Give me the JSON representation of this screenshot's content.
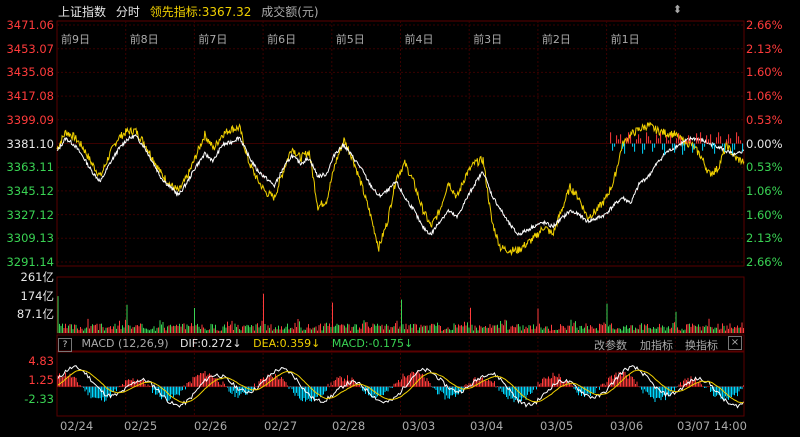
{
  "header": {
    "index_name": "上证指数",
    "period": "分时",
    "leader_label": "领先指标:3367.32",
    "volume_label": "成交额(元)"
  },
  "pin_icon": "pin-icon",
  "price_axis": {
    "left": [
      "3471.06",
      "3453.07",
      "3435.08",
      "3417.08",
      "3399.09",
      "3381.10",
      "3363.11",
      "3345.12",
      "3327.12",
      "3309.13",
      "3291.14"
    ],
    "right": [
      "2.66%",
      "2.13%",
      "1.60%",
      "1.06%",
      "0.53%",
      "0.00%",
      "0.53%",
      "1.06%",
      "1.60%",
      "2.13%",
      "2.66%"
    ]
  },
  "day_labels": [
    "前9日",
    "前8日",
    "前7日",
    "前6日",
    "前5日",
    "前4日",
    "前3日",
    "前2日",
    "前1日"
  ],
  "volume_axis": [
    "261亿",
    "174亿",
    "87.1亿"
  ],
  "macd": {
    "help": "?",
    "name": "MACD (12,26,9)",
    "dif": "DIF:0.272↓",
    "dea": "DEA:0.359↓",
    "macd": "MACD:-0.175↓",
    "axis": [
      "4.83",
      "1.25",
      "-2.33"
    ],
    "tools": {
      "edit": "改参数",
      "add": "加指标",
      "switch": "换指标",
      "close": "×"
    }
  },
  "x_axis": [
    "02/24",
    "02/25",
    "02/26",
    "02/27",
    "02/28",
    "03/03",
    "03/04",
    "03/05",
    "03/06",
    "03/07 14:00"
  ],
  "colors": {
    "up": "#ff3b3b",
    "down": "#39d353",
    "price": "#ffffff",
    "leader": "#f0d000",
    "grid": "#3a0000",
    "macd_neg": "#00d8ff"
  },
  "chart_data": {
    "type": "line",
    "days": [
      "02/24",
      "02/25",
      "02/26",
      "02/27",
      "02/28",
      "03/03",
      "03/04",
      "03/05",
      "03/06",
      "03/07"
    ],
    "series": [
      {
        "values": [
          3375,
          3385,
          3380,
          3371,
          3360,
          3352,
          3365,
          3376,
          3384,
          3387,
          3379,
          3367,
          3355,
          3348,
          3342,
          3352,
          3364,
          3373,
          3368,
          3380,
          3382,
          3386,
          3372,
          3361,
          3355,
          3349,
          3362,
          3372,
          3366,
          3370,
          3356,
          3358,
          3374,
          3380,
          3371,
          3362,
          3350,
          3341,
          3345,
          3352,
          3340,
          3331,
          3318,
          3312,
          3322,
          3330,
          3325,
          3338,
          3350,
          3360,
          3342,
          3331,
          3320,
          3312,
          3315,
          3319,
          3321,
          3318,
          3324,
          3330,
          3327,
          3322,
          3324,
          3327,
          3334,
          3340,
          3336,
          3351,
          3356,
          3366,
          3374,
          3378,
          3382,
          3385,
          3384,
          3381,
          3379,
          3375,
          3372,
          3376
        ]
      },
      {
        "name": "领先指标",
        "values": [
          3377,
          3390,
          3386,
          3378,
          3366,
          3356,
          3372,
          3385,
          3390,
          3391,
          3382,
          3370,
          3358,
          3350,
          3345,
          3356,
          3372,
          3388,
          3377,
          3388,
          3392,
          3393,
          3368,
          3354,
          3344,
          3340,
          3360,
          3378,
          3370,
          3375,
          3333,
          3338,
          3366,
          3384,
          3370,
          3350,
          3328,
          3302,
          3322,
          3355,
          3366,
          3352,
          3332,
          3318,
          3330,
          3352,
          3340,
          3357,
          3366,
          3369,
          3322,
          3302,
          3300,
          3300,
          3305,
          3310,
          3318,
          3312,
          3330,
          3348,
          3340,
          3325,
          3330,
          3338,
          3352,
          3380,
          3388,
          3392,
          3395,
          3391,
          3389,
          3388,
          3383,
          3380,
          3372,
          3358,
          3362,
          3380,
          3370,
          3367.32
        ]
      }
    ],
    "volume": {
      "unit": "亿",
      "ylim": [
        0,
        261
      ],
      "session_open_peaks": [
        215,
        170,
        160,
        185,
        175,
        168,
        160,
        155,
        170,
        130
      ]
    },
    "ylim": [
      3291.14,
      3471.06
    ]
  }
}
